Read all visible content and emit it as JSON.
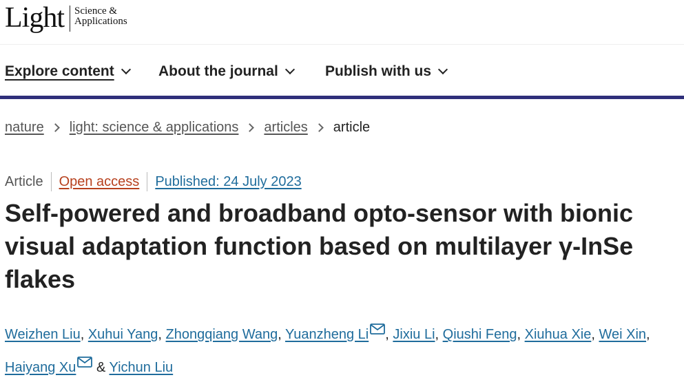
{
  "header": {
    "logo_main": "Light",
    "logo_sub_line1": "Science &",
    "logo_sub_line2": "Applications"
  },
  "nav": {
    "items": [
      {
        "label": "Explore content"
      },
      {
        "label": "About the journal"
      },
      {
        "label": "Publish with us"
      }
    ]
  },
  "breadcrumb": [
    {
      "label": "nature"
    },
    {
      "label": "light: science & applications"
    },
    {
      "label": "articles"
    },
    {
      "label": "article"
    }
  ],
  "meta": {
    "type": "Article",
    "access": "Open access",
    "published": "Published: 24 July 2023"
  },
  "article": {
    "title": "Self-powered and broadband opto-sensor with bionic visual adaptation function based on multilayer γ-InSe flakes"
  },
  "authors": [
    {
      "name": "Weizhen Liu"
    },
    {
      "name": "Xuhui Yang"
    },
    {
      "name": "Zhongqiang Wang"
    },
    {
      "name": "Yuanzheng Li"
    },
    {
      "name": "Jixiu Li"
    },
    {
      "name": "Qiushi Feng"
    },
    {
      "name": "Xiuhua Xie"
    },
    {
      "name": "Wei Xin"
    },
    {
      "name": "Haiyang Xu"
    },
    {
      "name": "Yichun Liu"
    }
  ],
  "authors_sep": {
    "comma": ",",
    "amp": "&"
  },
  "colors": {
    "accent_bar": "#2f2f7a",
    "link": "#1f6c9c",
    "open_access": "#b7411e"
  }
}
